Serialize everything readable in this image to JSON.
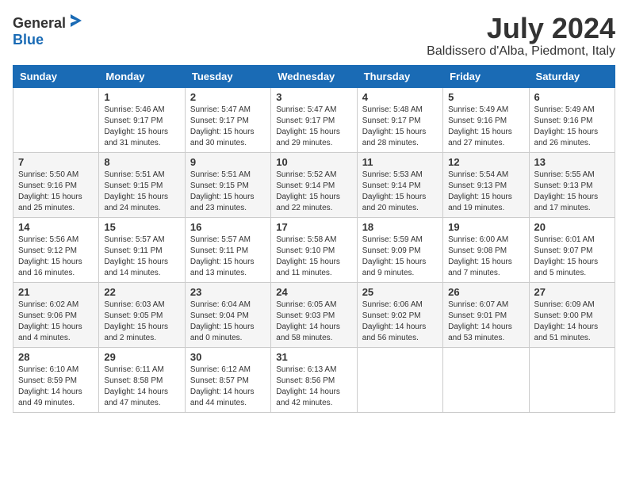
{
  "header": {
    "logo_general": "General",
    "logo_blue": "Blue",
    "month": "July 2024",
    "location": "Baldissero d'Alba, Piedmont, Italy"
  },
  "weekdays": [
    "Sunday",
    "Monday",
    "Tuesday",
    "Wednesday",
    "Thursday",
    "Friday",
    "Saturday"
  ],
  "weeks": [
    [
      {
        "day": "",
        "sunrise": "",
        "sunset": "",
        "daylight": ""
      },
      {
        "day": "1",
        "sunrise": "Sunrise: 5:46 AM",
        "sunset": "Sunset: 9:17 PM",
        "daylight": "Daylight: 15 hours and 31 minutes."
      },
      {
        "day": "2",
        "sunrise": "Sunrise: 5:47 AM",
        "sunset": "Sunset: 9:17 PM",
        "daylight": "Daylight: 15 hours and 30 minutes."
      },
      {
        "day": "3",
        "sunrise": "Sunrise: 5:47 AM",
        "sunset": "Sunset: 9:17 PM",
        "daylight": "Daylight: 15 hours and 29 minutes."
      },
      {
        "day": "4",
        "sunrise": "Sunrise: 5:48 AM",
        "sunset": "Sunset: 9:17 PM",
        "daylight": "Daylight: 15 hours and 28 minutes."
      },
      {
        "day": "5",
        "sunrise": "Sunrise: 5:49 AM",
        "sunset": "Sunset: 9:16 PM",
        "daylight": "Daylight: 15 hours and 27 minutes."
      },
      {
        "day": "6",
        "sunrise": "Sunrise: 5:49 AM",
        "sunset": "Sunset: 9:16 PM",
        "daylight": "Daylight: 15 hours and 26 minutes."
      }
    ],
    [
      {
        "day": "7",
        "sunrise": "Sunrise: 5:50 AM",
        "sunset": "Sunset: 9:16 PM",
        "daylight": "Daylight: 15 hours and 25 minutes."
      },
      {
        "day": "8",
        "sunrise": "Sunrise: 5:51 AM",
        "sunset": "Sunset: 9:15 PM",
        "daylight": "Daylight: 15 hours and 24 minutes."
      },
      {
        "day": "9",
        "sunrise": "Sunrise: 5:51 AM",
        "sunset": "Sunset: 9:15 PM",
        "daylight": "Daylight: 15 hours and 23 minutes."
      },
      {
        "day": "10",
        "sunrise": "Sunrise: 5:52 AM",
        "sunset": "Sunset: 9:14 PM",
        "daylight": "Daylight: 15 hours and 22 minutes."
      },
      {
        "day": "11",
        "sunrise": "Sunrise: 5:53 AM",
        "sunset": "Sunset: 9:14 PM",
        "daylight": "Daylight: 15 hours and 20 minutes."
      },
      {
        "day": "12",
        "sunrise": "Sunrise: 5:54 AM",
        "sunset": "Sunset: 9:13 PM",
        "daylight": "Daylight: 15 hours and 19 minutes."
      },
      {
        "day": "13",
        "sunrise": "Sunrise: 5:55 AM",
        "sunset": "Sunset: 9:13 PM",
        "daylight": "Daylight: 15 hours and 17 minutes."
      }
    ],
    [
      {
        "day": "14",
        "sunrise": "Sunrise: 5:56 AM",
        "sunset": "Sunset: 9:12 PM",
        "daylight": "Daylight: 15 hours and 16 minutes."
      },
      {
        "day": "15",
        "sunrise": "Sunrise: 5:57 AM",
        "sunset": "Sunset: 9:11 PM",
        "daylight": "Daylight: 15 hours and 14 minutes."
      },
      {
        "day": "16",
        "sunrise": "Sunrise: 5:57 AM",
        "sunset": "Sunset: 9:11 PM",
        "daylight": "Daylight: 15 hours and 13 minutes."
      },
      {
        "day": "17",
        "sunrise": "Sunrise: 5:58 AM",
        "sunset": "Sunset: 9:10 PM",
        "daylight": "Daylight: 15 hours and 11 minutes."
      },
      {
        "day": "18",
        "sunrise": "Sunrise: 5:59 AM",
        "sunset": "Sunset: 9:09 PM",
        "daylight": "Daylight: 15 hours and 9 minutes."
      },
      {
        "day": "19",
        "sunrise": "Sunrise: 6:00 AM",
        "sunset": "Sunset: 9:08 PM",
        "daylight": "Daylight: 15 hours and 7 minutes."
      },
      {
        "day": "20",
        "sunrise": "Sunrise: 6:01 AM",
        "sunset": "Sunset: 9:07 PM",
        "daylight": "Daylight: 15 hours and 5 minutes."
      }
    ],
    [
      {
        "day": "21",
        "sunrise": "Sunrise: 6:02 AM",
        "sunset": "Sunset: 9:06 PM",
        "daylight": "Daylight: 15 hours and 4 minutes."
      },
      {
        "day": "22",
        "sunrise": "Sunrise: 6:03 AM",
        "sunset": "Sunset: 9:05 PM",
        "daylight": "Daylight: 15 hours and 2 minutes."
      },
      {
        "day": "23",
        "sunrise": "Sunrise: 6:04 AM",
        "sunset": "Sunset: 9:04 PM",
        "daylight": "Daylight: 15 hours and 0 minutes."
      },
      {
        "day": "24",
        "sunrise": "Sunrise: 6:05 AM",
        "sunset": "Sunset: 9:03 PM",
        "daylight": "Daylight: 14 hours and 58 minutes."
      },
      {
        "day": "25",
        "sunrise": "Sunrise: 6:06 AM",
        "sunset": "Sunset: 9:02 PM",
        "daylight": "Daylight: 14 hours and 56 minutes."
      },
      {
        "day": "26",
        "sunrise": "Sunrise: 6:07 AM",
        "sunset": "Sunset: 9:01 PM",
        "daylight": "Daylight: 14 hours and 53 minutes."
      },
      {
        "day": "27",
        "sunrise": "Sunrise: 6:09 AM",
        "sunset": "Sunset: 9:00 PM",
        "daylight": "Daylight: 14 hours and 51 minutes."
      }
    ],
    [
      {
        "day": "28",
        "sunrise": "Sunrise: 6:10 AM",
        "sunset": "Sunset: 8:59 PM",
        "daylight": "Daylight: 14 hours and 49 minutes."
      },
      {
        "day": "29",
        "sunrise": "Sunrise: 6:11 AM",
        "sunset": "Sunset: 8:58 PM",
        "daylight": "Daylight: 14 hours and 47 minutes."
      },
      {
        "day": "30",
        "sunrise": "Sunrise: 6:12 AM",
        "sunset": "Sunset: 8:57 PM",
        "daylight": "Daylight: 14 hours and 44 minutes."
      },
      {
        "day": "31",
        "sunrise": "Sunrise: 6:13 AM",
        "sunset": "Sunset: 8:56 PM",
        "daylight": "Daylight: 14 hours and 42 minutes."
      },
      {
        "day": "",
        "sunrise": "",
        "sunset": "",
        "daylight": ""
      },
      {
        "day": "",
        "sunrise": "",
        "sunset": "",
        "daylight": ""
      },
      {
        "day": "",
        "sunrise": "",
        "sunset": "",
        "daylight": ""
      }
    ]
  ]
}
